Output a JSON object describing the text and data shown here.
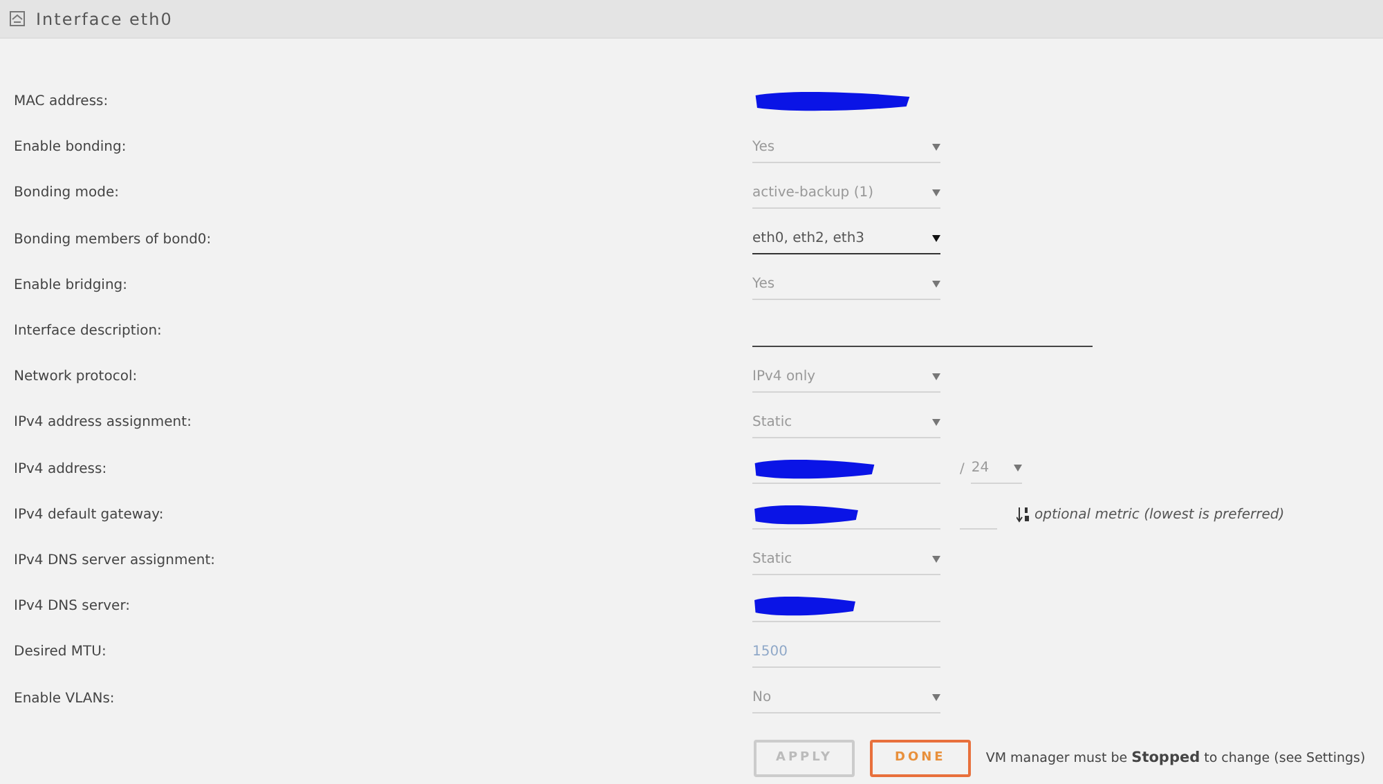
{
  "header": {
    "title": "Interface eth0"
  },
  "rows": [
    {
      "label": "MAC address:",
      "kind": "masked",
      "underline": false
    },
    {
      "label": "Enable bonding:",
      "kind": "select",
      "value": "Yes",
      "disabled": true
    },
    {
      "label": "Bonding mode:",
      "kind": "select",
      "value": "active-backup (1)",
      "disabled": true
    },
    {
      "label": "Bonding members of bond0:",
      "kind": "select",
      "value": "eth0, eth2, eth3",
      "disabled": false
    },
    {
      "label": "Enable bridging:",
      "kind": "select",
      "value": "Yes",
      "disabled": true
    },
    {
      "label": "Interface description:",
      "kind": "text"
    },
    {
      "label": "Network protocol:",
      "kind": "select",
      "value": "IPv4 only",
      "disabled": true
    },
    {
      "label": "IPv4 address assignment:",
      "kind": "select",
      "value": "Static",
      "disabled": true
    },
    {
      "label": "IPv4 address:",
      "kind": "ip",
      "prefix_separator": "/",
      "prefix": "24"
    },
    {
      "label": "IPv4 default gateway:",
      "kind": "gateway",
      "hint": "optional metric (lowest is preferred)"
    },
    {
      "label": "IPv4 DNS server assignment:",
      "kind": "select",
      "value": "Static",
      "disabled": true
    },
    {
      "label": "IPv4 DNS server:",
      "kind": "masked",
      "underline": true
    },
    {
      "label": "Desired MTU:",
      "kind": "number",
      "value": "1500"
    },
    {
      "label": "Enable VLANs:",
      "kind": "select",
      "value": "No",
      "disabled": true
    }
  ],
  "footer": {
    "buttons": [
      {
        "label": "APPLY",
        "kind": "apply",
        "disabled": true
      },
      {
        "label": "DONE",
        "kind": "done",
        "disabled": false
      }
    ],
    "note": "VM manager must be **Stopped** to change (see Settings)"
  }
}
